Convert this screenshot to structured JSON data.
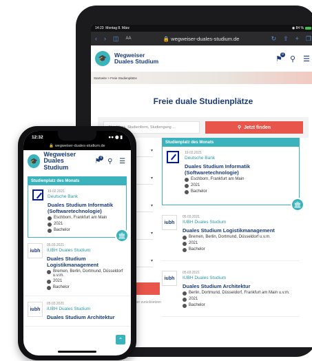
{
  "tablet": {
    "status": {
      "time": "14:23",
      "date": "Montag 8. März",
      "battery": "84 %"
    },
    "url": "wegweiser-duales-studium.de",
    "aa": "AA",
    "logo": {
      "line1": "Wegweiser",
      "line2": "Duales Studium"
    },
    "bookmark_count": "0",
    "breadcrumb": "Startseite > Freie Studienplätze",
    "page_title": "Freie duale Studienplätze",
    "search": {
      "placeholder": "Abschluss, Studienform, Studiengang ...",
      "button": "Jetzt finden"
    },
    "left_link": "Filter zurücksetzen",
    "featured": {
      "heading": "Studienplatz des Monats",
      "date": "19.02.2021",
      "company": "Deutsche Bank",
      "title": "Duales Studium Informatik (Softwaretechnologie)",
      "location": "Eschborn, Frankfurt am Main",
      "year": "2021",
      "degree": "Bachelor"
    },
    "jobs": [
      {
        "logo": "iubh",
        "date": "05.03.2021",
        "company": "IUBH Duales Studium",
        "title": "Duales Studium Logistikmanagement",
        "location": "Bremen, Berlin, Dortmund, Düsseldorf u.v.m.",
        "year": "2021",
        "degree": "Bachelor"
      },
      {
        "logo": "iubh",
        "date": "05.03.2021",
        "company": "IUBH Duales Studium",
        "title": "Duales Studium Architektur",
        "location": "Berlin, Dortmund, Düsseldorf, Frankfurt am Main u.v.m.",
        "year": "2021",
        "degree": "Bachelor"
      }
    ]
  },
  "phone": {
    "time": "12:32",
    "url": "wegweiser-duales-studium.de",
    "logo": {
      "line1": "Wegweiser",
      "line2": "Duales Studium"
    },
    "bookmark_count": "0",
    "featured": {
      "heading": "Studienplatz des Monats",
      "date": "19.02.2021",
      "company": "Deutsche Bank",
      "title": "Duales Studium Informatik (Softwaretechnologie)",
      "location": "Eschborn, Frankfurt am Main",
      "year": "2021",
      "degree": "Bachelor"
    },
    "jobs": [
      {
        "logo": "iubh",
        "date": "05.03.2021",
        "company": "IUBH Duales Studium",
        "title": "Duales Studium Logistikmanagement",
        "location": "Bremen, Berlin, Dortmund, Düsseldorf u.v.m.",
        "year": "2021",
        "degree": "Bachelor"
      },
      {
        "logo": "iubh",
        "date": "05.03.2021",
        "company": "IUBH Duales Studium",
        "title": "Duales Studium Architektur"
      }
    ]
  },
  "colors": {
    "teal": "#3ab3bd",
    "navy": "#1a3b78",
    "red": "#e8554a"
  }
}
